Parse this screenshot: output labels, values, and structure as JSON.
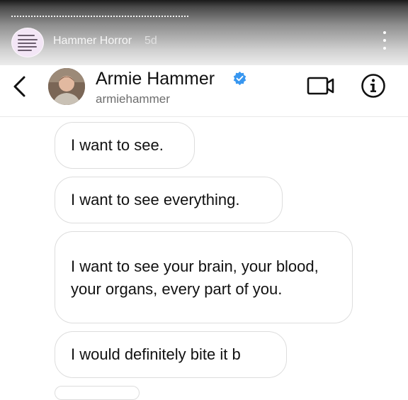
{
  "story": {
    "title": "Hammer Horror",
    "age": "5d"
  },
  "header": {
    "name": "Armie Hammer",
    "handle": "armiehammer"
  },
  "messages": [
    {
      "text": "I want to see."
    },
    {
      "text": "I want to see everything."
    },
    {
      "text": "I want to see your brain, your blood, your organs, every part of you."
    },
    {
      "text": "I would definitely bite it b"
    }
  ],
  "colors": {
    "verified": "#3897f0",
    "bubble_border": "#dddddd",
    "text": "#111111"
  }
}
